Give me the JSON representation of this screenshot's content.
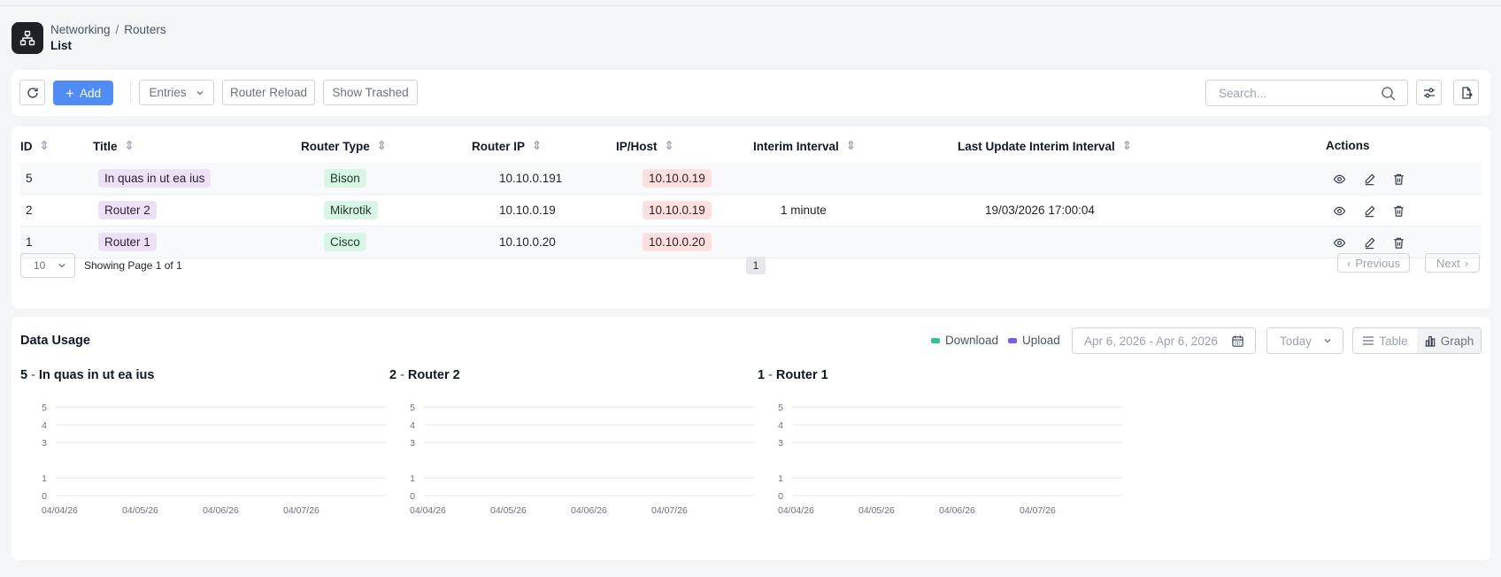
{
  "breadcrumb": {
    "section": "Networking",
    "separator": "/",
    "page": "Routers"
  },
  "page_title": "List",
  "toolbar": {
    "add_label": "Add",
    "entries_label": "Entries",
    "router_reload_label": "Router Reload",
    "show_trashed_label": "Show Trashed",
    "search_placeholder": "Search..."
  },
  "table": {
    "headers": [
      "ID",
      "Title",
      "Router Type",
      "Router IP",
      "IP/Host",
      "Interim Interval",
      "Last Update Interim Interval",
      "Actions"
    ],
    "rows": [
      {
        "id": "5",
        "title": "In quas in ut ea ius",
        "router_type": "Bison",
        "router_ip": "10.10.0.191",
        "ip_host": "10.10.0.19",
        "interim_interval": "",
        "last_update": ""
      },
      {
        "id": "2",
        "title": "Router 2",
        "router_type": "Mikrotik",
        "router_ip": "10.10.0.19",
        "ip_host": "10.10.0.19",
        "interim_interval": "1 minute",
        "last_update": "19/03/2026 17:00:04"
      },
      {
        "id": "1",
        "title": "Router 1",
        "router_type": "Cisco",
        "router_ip": "10.10.0.20",
        "ip_host": "10.10.0.20",
        "interim_interval": "",
        "last_update": ""
      }
    ]
  },
  "pagination": {
    "page_size": "10",
    "info": "Showing Page 1 of 1",
    "current_page": "1",
    "previous_label": "Previous",
    "next_label": "Next"
  },
  "usage": {
    "title": "Data Usage",
    "legend_download": "Download",
    "legend_upload": "Upload",
    "date_range": "Apr 6, 2026 - Apr 6, 2026",
    "period": "Today",
    "view_table": "Table",
    "view_graph": "Graph",
    "charts": [
      {
        "id": "5",
        "name": "In quas in ut ea ius"
      },
      {
        "id": "2",
        "name": "Router 2"
      },
      {
        "id": "1",
        "name": "Router 1"
      }
    ]
  },
  "colors": {
    "primary": "#4f8cf6",
    "download": "#34c38f",
    "upload": "#7b5cf0",
    "badge_purple": "#ede1f8",
    "badge_green": "#d8f5e6",
    "badge_red": "#fde0e0"
  },
  "chart_data": [
    {
      "type": "line",
      "title": "5 - In quas in ut ea ius",
      "x": [
        "04/04/26",
        "04/05/26",
        "04/06/26",
        "04/07/26"
      ],
      "yticks": [
        0,
        1,
        3,
        4,
        5
      ],
      "ylim": [
        0,
        5
      ],
      "series": [],
      "grid": true
    },
    {
      "type": "line",
      "title": "2 - Router 2",
      "x": [
        "04/04/26",
        "04/05/26",
        "04/06/26",
        "04/07/26"
      ],
      "yticks": [
        0,
        1,
        3,
        4,
        5
      ],
      "ylim": [
        0,
        5
      ],
      "series": [],
      "grid": true
    },
    {
      "type": "line",
      "title": "1 - Router 1",
      "x": [
        "04/04/26",
        "04/05/26",
        "04/06/26",
        "04/07/26"
      ],
      "yticks": [
        0,
        1,
        3,
        4,
        5
      ],
      "ylim": [
        0,
        5
      ],
      "series": [],
      "grid": true
    }
  ]
}
